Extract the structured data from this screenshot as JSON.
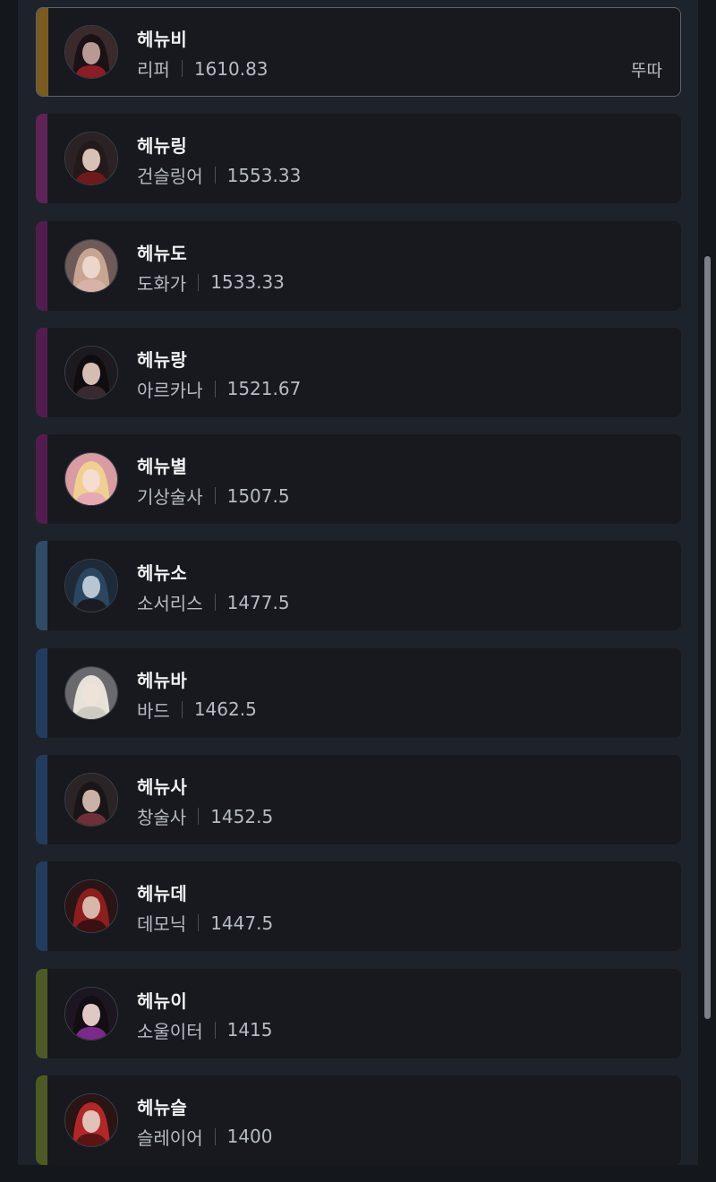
{
  "characters": [
    {
      "name": "헤뉴비",
      "class": "리퍼",
      "score": "1610.83",
      "tag": "뚜따",
      "stripe": "#7a5a1e",
      "avatar": {
        "bg": "#3a2a2c",
        "hair": "#1a1214",
        "skin": "#b89a94",
        "accent": "#8a1e24"
      }
    },
    {
      "name": "헤뉴링",
      "class": "건슬링어",
      "score": "1553.33",
      "stripe": "#5e2458",
      "avatar": {
        "bg": "#2a2224",
        "hair": "#241a1a",
        "skin": "#d8c2b6",
        "accent": "#6e1a1c"
      }
    },
    {
      "name": "헤뉴도",
      "class": "도화가",
      "score": "1533.33",
      "stripe": "#521d4e",
      "avatar": {
        "bg": "#6e5a58",
        "hair": "#c7a592",
        "skin": "#ecd6cc",
        "accent": "#d6b2a8"
      }
    },
    {
      "name": "헤뉴랑",
      "class": "아르카나",
      "score": "1521.67",
      "stripe": "#521d4e",
      "avatar": {
        "bg": "#1c1a1e",
        "hair": "#0f0d10",
        "skin": "#d4bdb2",
        "accent": "#3a2a30"
      }
    },
    {
      "name": "헤뉴별",
      "class": "기상술사",
      "score": "1507.5",
      "stripe": "#521d4e",
      "avatar": {
        "bg": "#d89ca2",
        "hair": "#f0cf92",
        "skin": "#f5ddd2",
        "accent": "#e7a8b2"
      }
    },
    {
      "name": "헤뉴소",
      "class": "소서리스",
      "score": "1477.5",
      "stripe": "#304b68",
      "avatar": {
        "bg": "#1e2a38",
        "hair": "#2a4660",
        "skin": "#b8c6d4",
        "accent": "#1a1c22"
      }
    },
    {
      "name": "헤뉴바",
      "class": "바드",
      "score": "1462.5",
      "stripe": "#223c5e",
      "avatar": {
        "bg": "#6a6a6e",
        "hair": "#e6e2da",
        "skin": "#efe2d8",
        "accent": "#cfcac2"
      }
    },
    {
      "name": "헤뉴사",
      "class": "창술사",
      "score": "1452.5",
      "stripe": "#223c5e",
      "avatar": {
        "bg": "#2a2426",
        "hair": "#1a1516",
        "skin": "#cbb2a8",
        "accent": "#6e3038"
      }
    },
    {
      "name": "헤뉴데",
      "class": "데모닉",
      "score": "1447.5",
      "stripe": "#223c5e",
      "avatar": {
        "bg": "#2a1416",
        "hair": "#8c1e1e",
        "skin": "#d8b6aa",
        "accent": "#3a1012"
      }
    },
    {
      "name": "헤뉴이",
      "class": "소울이터",
      "score": "1415",
      "stripe": "#4e5a26",
      "avatar": {
        "bg": "#1c1622",
        "hair": "#120e14",
        "skin": "#e0c8c4",
        "accent": "#7a2a8a"
      }
    },
    {
      "name": "헤뉴슬",
      "class": "슬레이어",
      "score": "1400",
      "stripe": "#4e5a26",
      "avatar": {
        "bg": "#2a1414",
        "hair": "#b0282a",
        "skin": "#e2c2b6",
        "accent": "#5a1414"
      }
    }
  ]
}
